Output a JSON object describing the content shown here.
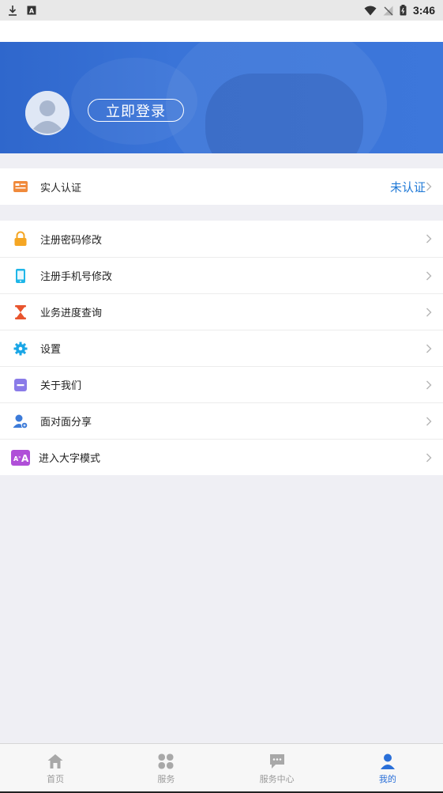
{
  "status_bar": {
    "time": "3:46",
    "icons": [
      "download-icon",
      "a-badge-icon",
      "wifi-icon",
      "no-signal-icon",
      "battery-icon"
    ]
  },
  "profile": {
    "login_button": "立即登录"
  },
  "verification": {
    "label": "实人认证",
    "status": "未认证",
    "icon": "id-card-icon"
  },
  "menu": {
    "items": [
      {
        "label": "注册密码修改",
        "icon": "lock-icon"
      },
      {
        "label": "注册手机号修改",
        "icon": "phone-icon"
      },
      {
        "label": "业务进度查询",
        "icon": "hourglass-icon"
      },
      {
        "label": "设置",
        "icon": "gear-icon"
      },
      {
        "label": "关于我们",
        "icon": "info-card-icon"
      },
      {
        "label": "面对面分享",
        "icon": "share-user-icon"
      },
      {
        "label": "进入大字模式",
        "icon": "large-text-icon"
      }
    ]
  },
  "tabbar": {
    "tabs": [
      {
        "label": "首页",
        "icon": "home-icon",
        "active": false
      },
      {
        "label": "服务",
        "icon": "grid-icon",
        "active": false
      },
      {
        "label": "服务中心",
        "icon": "chat-icon",
        "active": false
      },
      {
        "label": "我的",
        "icon": "user-icon",
        "active": true
      }
    ]
  },
  "colors": {
    "accent": "#2a6fd8",
    "banner": "#3a74d8",
    "status_text": "#1e78d6"
  }
}
